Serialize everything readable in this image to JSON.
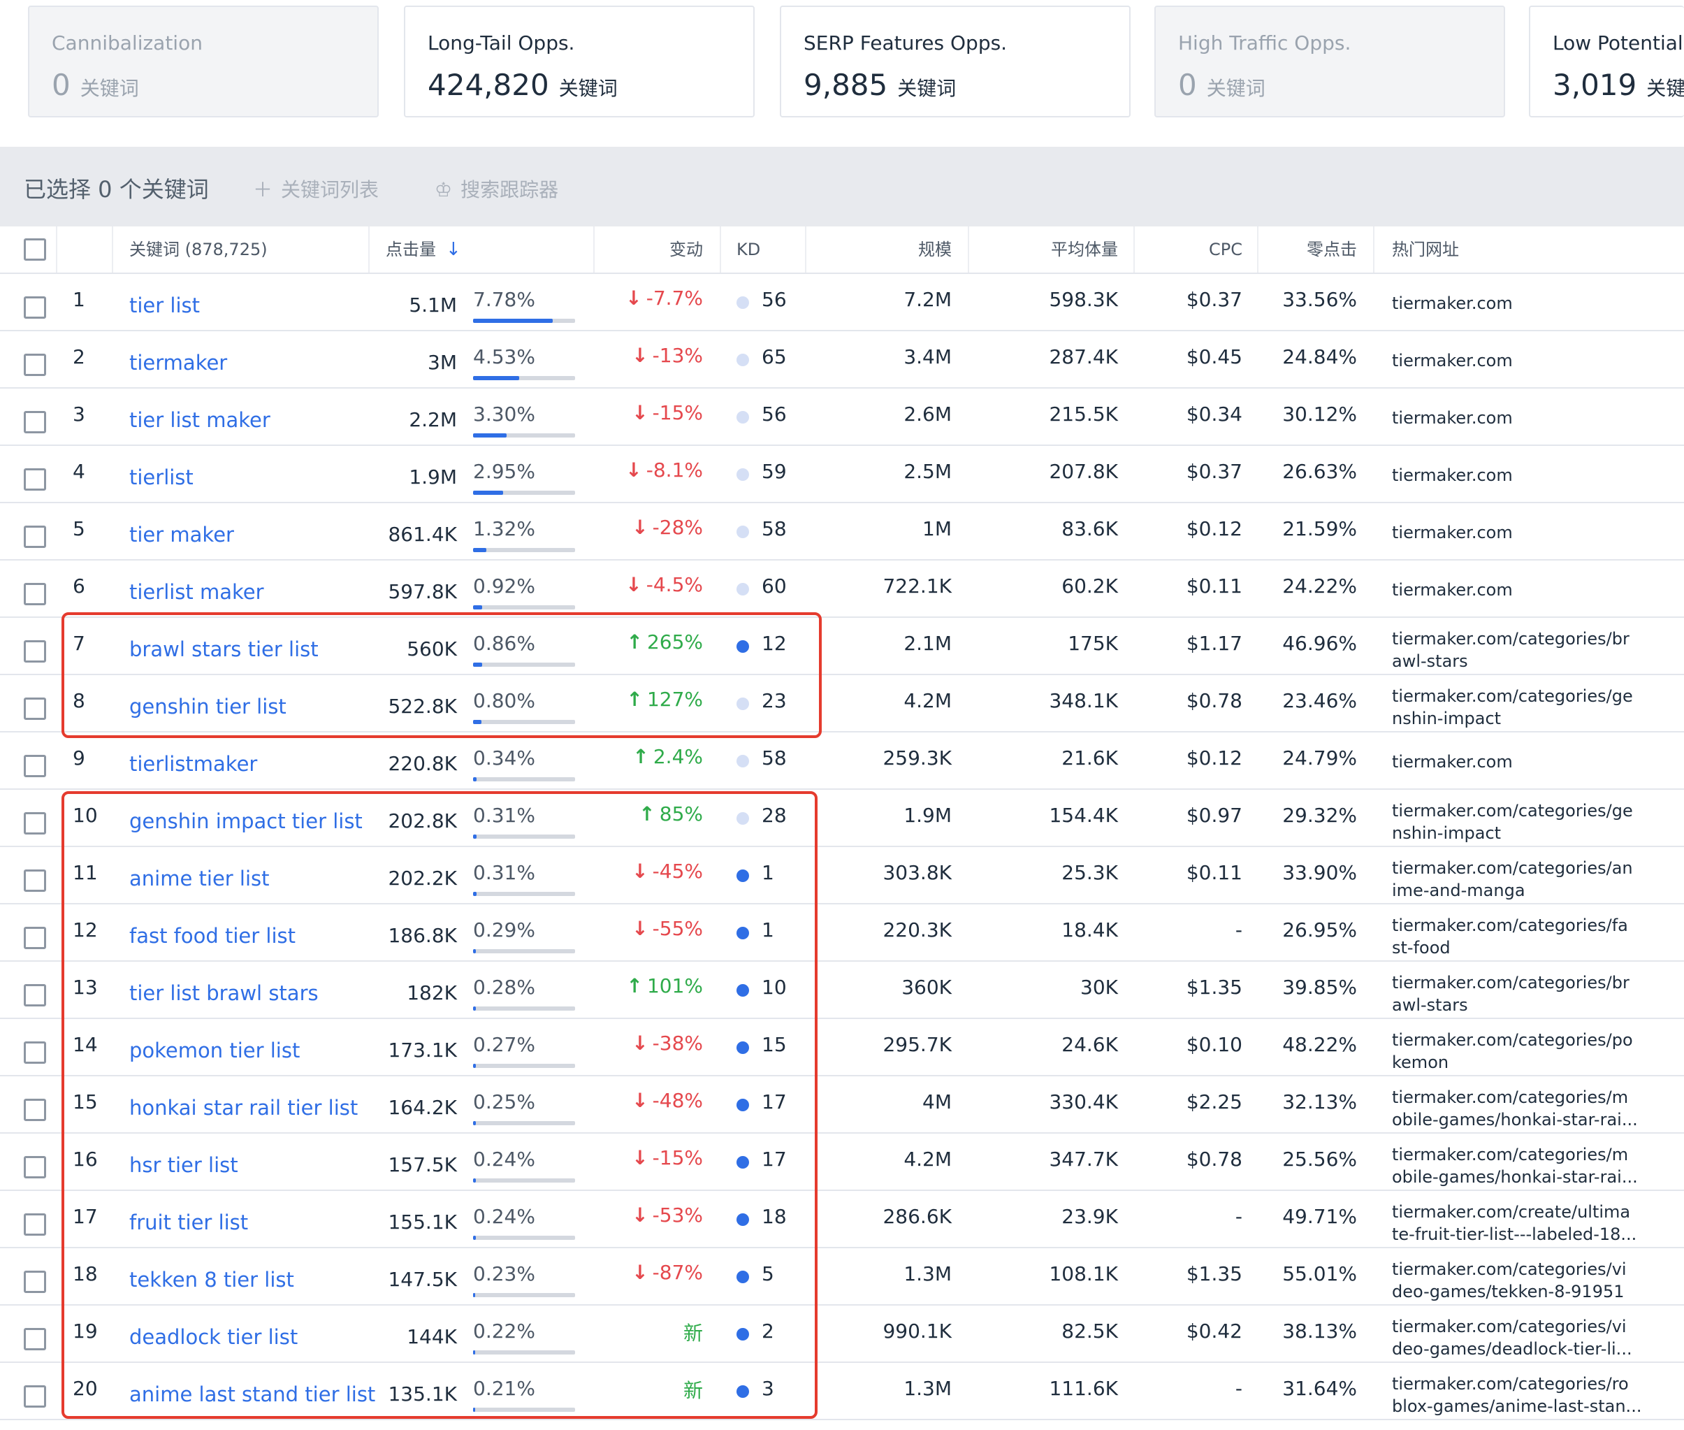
{
  "cards": [
    {
      "title": "Cannibalization",
      "value": "0",
      "unit": "关键词",
      "dim": true
    },
    {
      "title": "Long-Tail Opps.",
      "value": "424,820",
      "unit": "关键词",
      "dim": false
    },
    {
      "title": "SERP Features Opps.",
      "value": "9,885",
      "unit": "关键词",
      "dim": false
    },
    {
      "title": "High Traffic Opps.",
      "value": "0",
      "unit": "关键词",
      "dim": true
    },
    {
      "title": "Low Potential K",
      "value": "3,019",
      "unit": "关键词",
      "dim": false
    }
  ],
  "toolbar": {
    "selected_label": "已选择 0 个关键词",
    "keyword_list_label": "关键词列表",
    "keyword_list_icon": "plus-icon",
    "tracker_label": "搜索跟踪器",
    "tracker_icon": "crown-icon"
  },
  "table": {
    "columns": {
      "keyword": "关键词 (878,725)",
      "clicks": "点击量",
      "change": "变动",
      "kd": "KD",
      "scale": "规模",
      "avg_volume": "平均体量",
      "cpc": "CPC",
      "zero_click": "零点击",
      "top_url": "热门网址"
    },
    "sort_icon": "arrow-down-icon",
    "colors": {
      "link": "#2f6ee5",
      "down": "#e5484d",
      "up": "#2fab4a",
      "kd_low": "#d5dff5",
      "kd_high": "#2f6ee5",
      "highlight": "#e53b2e"
    },
    "rows": [
      {
        "idx": "1",
        "kw": "tier list",
        "vol": "5.1M",
        "share": "7.78%",
        "bar": 0.0778,
        "dir": "down",
        "chg": "-7.7%",
        "kd_level": "light",
        "kd": "56",
        "scale": "7.2M",
        "avg": "598.3K",
        "cpc": "$0.37",
        "zero": "33.56%",
        "url1": "tiermaker.com",
        "url2": ""
      },
      {
        "idx": "2",
        "kw": "tiermaker",
        "vol": "3M",
        "share": "4.53%",
        "bar": 0.0453,
        "dir": "down",
        "chg": "-13%",
        "kd_level": "light",
        "kd": "65",
        "scale": "3.4M",
        "avg": "287.4K",
        "cpc": "$0.45",
        "zero": "24.84%",
        "url1": "tiermaker.com",
        "url2": ""
      },
      {
        "idx": "3",
        "kw": "tier list maker",
        "vol": "2.2M",
        "share": "3.30%",
        "bar": 0.033,
        "dir": "down",
        "chg": "-15%",
        "kd_level": "light",
        "kd": "56",
        "scale": "2.6M",
        "avg": "215.5K",
        "cpc": "$0.34",
        "zero": "30.12%",
        "url1": "tiermaker.com",
        "url2": ""
      },
      {
        "idx": "4",
        "kw": "tierlist",
        "vol": "1.9M",
        "share": "2.95%",
        "bar": 0.0295,
        "dir": "down",
        "chg": "-8.1%",
        "kd_level": "light",
        "kd": "59",
        "scale": "2.5M",
        "avg": "207.8K",
        "cpc": "$0.37",
        "zero": "26.63%",
        "url1": "tiermaker.com",
        "url2": ""
      },
      {
        "idx": "5",
        "kw": "tier maker",
        "vol": "861.4K",
        "share": "1.32%",
        "bar": 0.0132,
        "dir": "down",
        "chg": "-28%",
        "kd_level": "light",
        "kd": "58",
        "scale": "1M",
        "avg": "83.6K",
        "cpc": "$0.12",
        "zero": "21.59%",
        "url1": "tiermaker.com",
        "url2": ""
      },
      {
        "idx": "6",
        "kw": "tierlist maker",
        "vol": "597.8K",
        "share": "0.92%",
        "bar": 0.0092,
        "dir": "down",
        "chg": "-4.5%",
        "kd_level": "light",
        "kd": "60",
        "scale": "722.1K",
        "avg": "60.2K",
        "cpc": "$0.11",
        "zero": "24.22%",
        "url1": "tiermaker.com",
        "url2": ""
      },
      {
        "idx": "7",
        "kw": "brawl stars tier list",
        "vol": "560K",
        "share": "0.86%",
        "bar": 0.0086,
        "dir": "up",
        "chg": "265%",
        "kd_level": "dark",
        "kd": "12",
        "scale": "2.1M",
        "avg": "175K",
        "cpc": "$1.17",
        "zero": "46.96%",
        "url1": "tiermaker.com/categories/br",
        "url2": "awl-stars"
      },
      {
        "idx": "8",
        "kw": "genshin tier list",
        "vol": "522.8K",
        "share": "0.80%",
        "bar": 0.008,
        "dir": "up",
        "chg": "127%",
        "kd_level": "light",
        "kd": "23",
        "scale": "4.2M",
        "avg": "348.1K",
        "cpc": "$0.78",
        "zero": "23.46%",
        "url1": "tiermaker.com/categories/ge",
        "url2": "nshin-impact"
      },
      {
        "idx": "9",
        "kw": "tierlistmaker",
        "vol": "220.8K",
        "share": "0.34%",
        "bar": 0.0034,
        "dir": "up",
        "chg": "2.4%",
        "kd_level": "light",
        "kd": "58",
        "scale": "259.3K",
        "avg": "21.6K",
        "cpc": "$0.12",
        "zero": "24.79%",
        "url1": "tiermaker.com",
        "url2": ""
      },
      {
        "idx": "10",
        "kw": "genshin impact tier list",
        "vol": "202.8K",
        "share": "0.31%",
        "bar": 0.0031,
        "dir": "up",
        "chg": "85%",
        "kd_level": "light",
        "kd": "28",
        "scale": "1.9M",
        "avg": "154.4K",
        "cpc": "$0.97",
        "zero": "29.32%",
        "url1": "tiermaker.com/categories/ge",
        "url2": "nshin-impact"
      },
      {
        "idx": "11",
        "kw": "anime tier list",
        "vol": "202.2K",
        "share": "0.31%",
        "bar": 0.0031,
        "dir": "down",
        "chg": "-45%",
        "kd_level": "dark",
        "kd": "1",
        "scale": "303.8K",
        "avg": "25.3K",
        "cpc": "$0.11",
        "zero": "33.90%",
        "url1": "tiermaker.com/categories/an",
        "url2": "ime-and-manga"
      },
      {
        "idx": "12",
        "kw": "fast food tier list",
        "vol": "186.8K",
        "share": "0.29%",
        "bar": 0.0029,
        "dir": "down",
        "chg": "-55%",
        "kd_level": "dark",
        "kd": "1",
        "scale": "220.3K",
        "avg": "18.4K",
        "cpc": "-",
        "zero": "26.95%",
        "url1": "tiermaker.com/categories/fa",
        "url2": "st-food"
      },
      {
        "idx": "13",
        "kw": "tier list brawl stars",
        "vol": "182K",
        "share": "0.28%",
        "bar": 0.0028,
        "dir": "up",
        "chg": "101%",
        "kd_level": "dark",
        "kd": "10",
        "scale": "360K",
        "avg": "30K",
        "cpc": "$1.35",
        "zero": "39.85%",
        "url1": "tiermaker.com/categories/br",
        "url2": "awl-stars"
      },
      {
        "idx": "14",
        "kw": "pokemon tier list",
        "vol": "173.1K",
        "share": "0.27%",
        "bar": 0.0027,
        "dir": "down",
        "chg": "-38%",
        "kd_level": "dark",
        "kd": "15",
        "scale": "295.7K",
        "avg": "24.6K",
        "cpc": "$0.10",
        "zero": "48.22%",
        "url1": "tiermaker.com/categories/po",
        "url2": "kemon"
      },
      {
        "idx": "15",
        "kw": "honkai star rail tier list",
        "vol": "164.2K",
        "share": "0.25%",
        "bar": 0.0025,
        "dir": "down",
        "chg": "-48%",
        "kd_level": "dark",
        "kd": "17",
        "scale": "4M",
        "avg": "330.4K",
        "cpc": "$2.25",
        "zero": "32.13%",
        "url1": "tiermaker.com/categories/m",
        "url2": "obile-games/honkai-star-rai..."
      },
      {
        "idx": "16",
        "kw": "hsr tier list",
        "vol": "157.5K",
        "share": "0.24%",
        "bar": 0.0024,
        "dir": "down",
        "chg": "-15%",
        "kd_level": "dark",
        "kd": "17",
        "scale": "4.2M",
        "avg": "347.7K",
        "cpc": "$0.78",
        "zero": "25.56%",
        "url1": "tiermaker.com/categories/m",
        "url2": "obile-games/honkai-star-rai..."
      },
      {
        "idx": "17",
        "kw": "fruit tier list",
        "vol": "155.1K",
        "share": "0.24%",
        "bar": 0.0024,
        "dir": "down",
        "chg": "-53%",
        "kd_level": "dark",
        "kd": "18",
        "scale": "286.6K",
        "avg": "23.9K",
        "cpc": "-",
        "zero": "49.71%",
        "url1": "tiermaker.com/create/ultima",
        "url2": "te-fruit-tier-list---labeled-18..."
      },
      {
        "idx": "18",
        "kw": "tekken 8 tier list",
        "vol": "147.5K",
        "share": "0.23%",
        "bar": 0.0023,
        "dir": "down",
        "chg": "-87%",
        "kd_level": "dark",
        "kd": "5",
        "scale": "1.3M",
        "avg": "108.1K",
        "cpc": "$1.35",
        "zero": "55.01%",
        "url1": "tiermaker.com/categories/vi",
        "url2": "deo-games/tekken-8-91951"
      },
      {
        "idx": "19",
        "kw": "deadlock tier list",
        "vol": "144K",
        "share": "0.22%",
        "bar": 0.0022,
        "dir": "new",
        "chg": "新",
        "kd_level": "dark",
        "kd": "2",
        "scale": "990.1K",
        "avg": "82.5K",
        "cpc": "$0.42",
        "zero": "38.13%",
        "url1": "tiermaker.com/categories/vi",
        "url2": "deo-games/deadlock-tier-li..."
      },
      {
        "idx": "20",
        "kw": "anime last stand tier list",
        "vol": "135.1K",
        "share": "0.21%",
        "bar": 0.0021,
        "dir": "new",
        "chg": "新",
        "kd_level": "dark",
        "kd": "3",
        "scale": "1.3M",
        "avg": "111.6K",
        "cpc": "-",
        "zero": "31.64%",
        "url1": "tiermaker.com/categories/ro",
        "url2": "blox-games/anime-last-stan..."
      }
    ]
  }
}
